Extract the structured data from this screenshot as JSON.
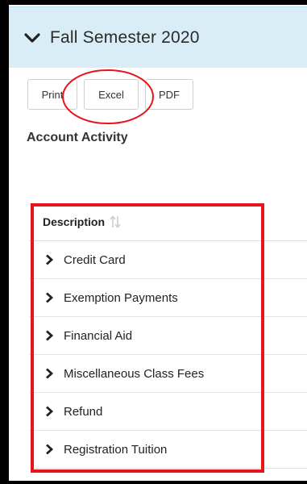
{
  "header": {
    "title": "Fall Semester 2020",
    "icon": "chevron-down-icon"
  },
  "toolbar": {
    "print_label": "Print",
    "excel_label": "Excel",
    "pdf_label": "PDF"
  },
  "section": {
    "title": "Account Activity"
  },
  "table": {
    "column_header": "Description",
    "rows": [
      {
        "label": "Credit Card"
      },
      {
        "label": "Exemption Payments"
      },
      {
        "label": "Financial Aid"
      },
      {
        "label": "Miscellaneous Class Fees"
      },
      {
        "label": "Refund"
      },
      {
        "label": "Registration Tuition"
      }
    ]
  },
  "colors": {
    "header_bg": "#d9edf7",
    "annotation_red": "#e8141b"
  }
}
